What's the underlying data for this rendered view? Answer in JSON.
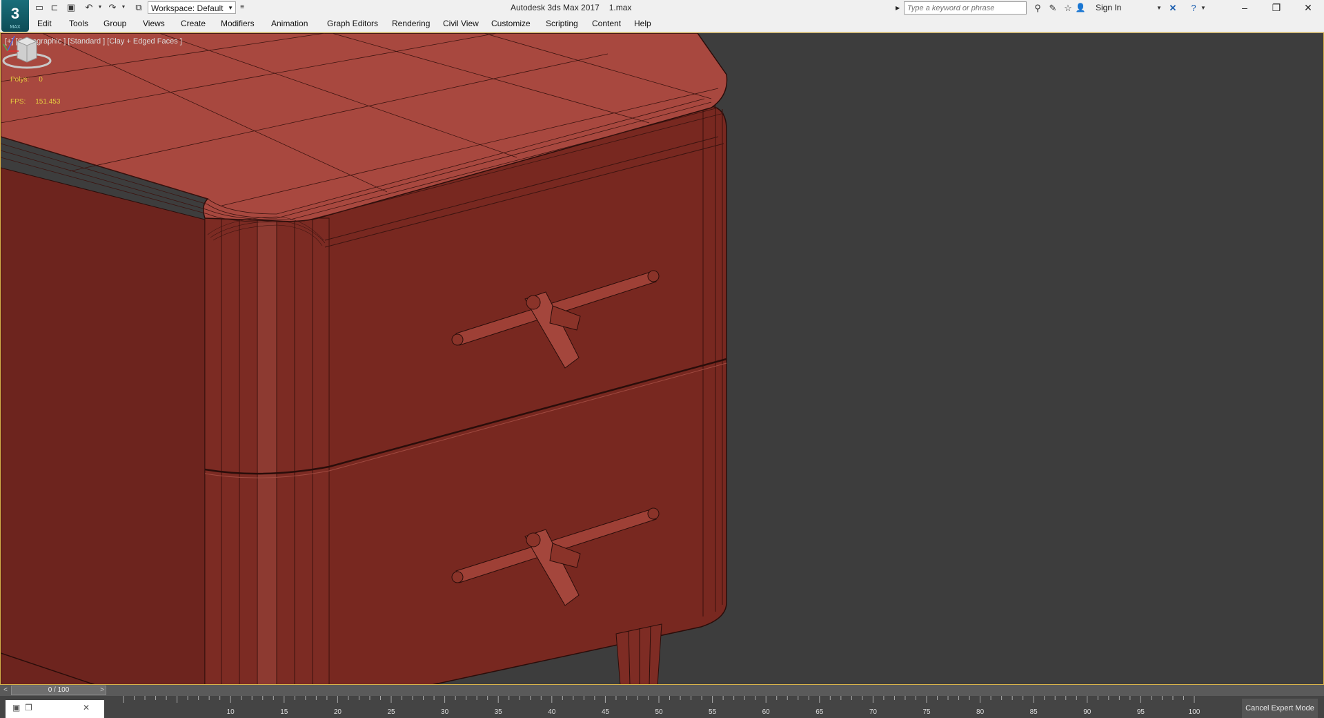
{
  "app": {
    "logo_text": "3",
    "logo_sub": "MAX",
    "title": "Autodesk 3ds Max 2017",
    "file": "1.max"
  },
  "toolbar": {
    "workspace": "Workspace: Default",
    "icons": [
      "new-file-icon",
      "open-file-icon",
      "save-icon",
      "undo-icon",
      "redo-icon",
      "project-icon"
    ]
  },
  "search": {
    "placeholder": "Type a keyword or phrase"
  },
  "user": {
    "sign_in": "Sign In"
  },
  "menu": [
    "Edit",
    "Tools",
    "Group",
    "Views",
    "Create",
    "Modifiers",
    "Animation",
    "Graph Editors",
    "Rendering",
    "Civil View",
    "Customize",
    "Scripting",
    "Content",
    "Help"
  ],
  "viewport": {
    "label": "[+] [Orthographic ] [Standard ] [Clay + Edged Faces ]",
    "polys_label": "Polys:",
    "polys_value": "0",
    "fps_label": "FPS:",
    "fps_value": "151.453",
    "object_color": "#7a2a22",
    "top_color": "#a8483f"
  },
  "timeslider": {
    "text": "0 / 100",
    "current_frame": 0,
    "total_frames": 100
  },
  "ruler": {
    "labels": [
      "10",
      "15",
      "20",
      "25",
      "30",
      "35",
      "40",
      "45",
      "50",
      "55",
      "60",
      "65",
      "70",
      "75",
      "80",
      "85",
      "90",
      "95",
      "100"
    ]
  },
  "expert": {
    "label": "Cancel Expert Mode"
  }
}
